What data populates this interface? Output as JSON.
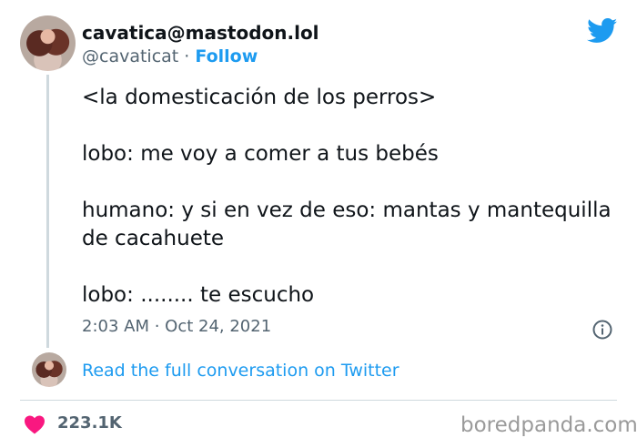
{
  "author": {
    "display_name": "cavatica@mastodon.lol",
    "handle": "@cavaticat",
    "separator": " · ",
    "follow_label": "Follow"
  },
  "tweet": {
    "lines": [
      "<la domesticación de los perros>",
      "lobo: me voy a comer a tus bebés",
      "humano: y si en vez de eso: mantas y mantequilla de cacahuete",
      "lobo: ........ te escucho"
    ],
    "timestamp": "2:03 AM · Oct 24, 2021"
  },
  "conversation": {
    "link_label": "Read the full conversation on Twitter"
  },
  "engagement": {
    "likes": "223.1K"
  },
  "watermark": "boredpanda.com",
  "colors": {
    "accent": "#1d9bf0",
    "heart": "#f91880",
    "muted": "#536471"
  },
  "icons": [
    "twitter-bird-icon",
    "info-icon",
    "heart-icon"
  ]
}
